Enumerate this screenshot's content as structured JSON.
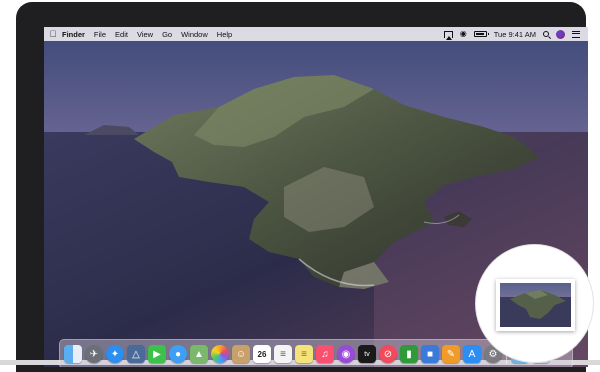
{
  "menubar": {
    "app_name": "Finder",
    "menus": [
      "File",
      "Edit",
      "View",
      "Go",
      "Window",
      "Help"
    ],
    "clock": "Tue 9:41 AM"
  },
  "dock": {
    "calendar_day": "26",
    "tv_label": "tv"
  },
  "icons": {
    "apple": "apple-logo-icon",
    "airplay": "airplay-icon",
    "wifi": "wifi-icon",
    "battery": "battery-icon",
    "search": "spotlight-search-icon",
    "siri": "siri-icon",
    "notifications": "notification-center-icon"
  },
  "thumbnail": {
    "description_type": "screenshot-preview"
  }
}
